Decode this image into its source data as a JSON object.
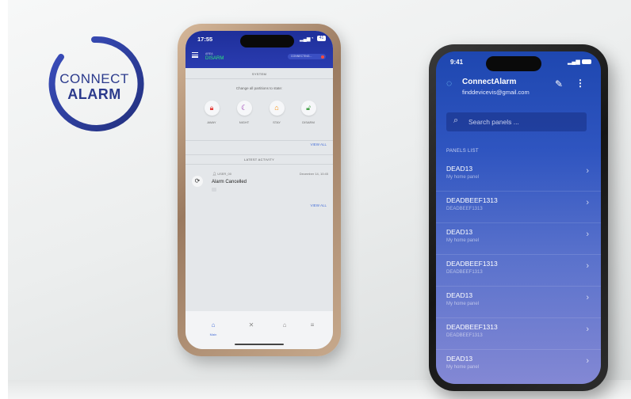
{
  "logo": {
    "line1": "CONNECT",
    "line2": "ALARM"
  },
  "phone1": {
    "time": "17:55",
    "battery": "41",
    "area_label": "AREA",
    "area_state": "DISARM",
    "connection": "CONNECTING...",
    "system_header": "SYSTEM",
    "change_text": "Change all partitions to state:",
    "arm_options": [
      {
        "label": "AWAY",
        "icon": "lock-icon",
        "color": "#e53935"
      },
      {
        "label": "NIGHT",
        "icon": "moon-icon",
        "color": "#8e24aa"
      },
      {
        "label": "STAY",
        "icon": "house-icon",
        "color": "#fb8c00"
      },
      {
        "label": "DISARM",
        "icon": "unlock-icon",
        "color": "#43a047"
      }
    ],
    "view_all": "VIEW ALL",
    "activity_header": "LATEST ACTIVITY",
    "activity": {
      "user": "USER_00",
      "date": "December 14, 10:45",
      "title": "Alarm Cancelled",
      "icon": "sync-icon"
    },
    "view_all_2": "VIEW ALL",
    "nav": {
      "main_label": "Main",
      "items": [
        "home-icon",
        "tools-icon",
        "house-icon",
        "list-icon"
      ]
    }
  },
  "phone2": {
    "time": "9:41",
    "title": "ConnectAlarm",
    "email": "finddevicevis@gmail.com",
    "search_placeholder": "Search panels ...",
    "panels_header": "PANELS LIST",
    "panels": [
      {
        "name": "DEAD13",
        "desc": "My home panel"
      },
      {
        "name": "DEADBEEF1313",
        "desc": "DEADBEEF1313"
      },
      {
        "name": "DEAD13",
        "desc": "My home panel"
      },
      {
        "name": "DEADBEEF1313",
        "desc": "DEADBEEF1313"
      },
      {
        "name": "DEAD13",
        "desc": "My home panel"
      },
      {
        "name": "DEADBEEF1313",
        "desc": "DEADBEEF1313"
      },
      {
        "name": "DEAD13",
        "desc": "My home panel"
      }
    ]
  },
  "colors": {
    "accent_blue": "#2a3cb0",
    "link_blue": "#4a72d8",
    "disarm_green": "#2ee87a",
    "logo_navy": "#2b3a8c"
  }
}
